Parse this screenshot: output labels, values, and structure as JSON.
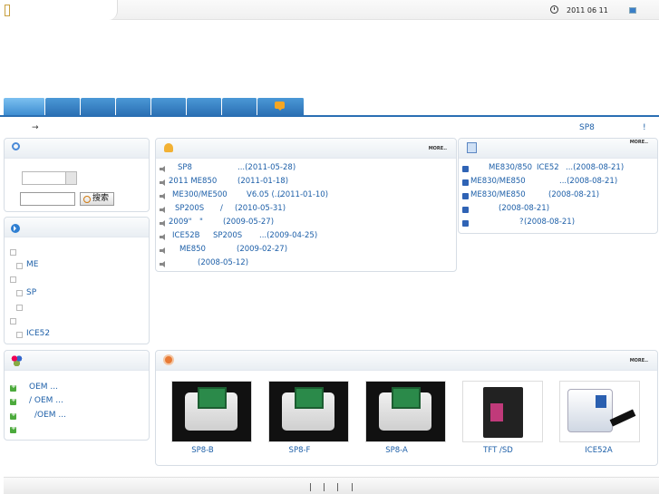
{
  "header": {
    "date": "2011 06 11"
  },
  "breadcrumb": {
    "arrow": "→"
  },
  "announcement": {
    "text": "SP8",
    "suffix": "!"
  },
  "search_box": {
    "button_label": "搜索"
  },
  "categories": {
    "items": [
      "",
      "ME",
      "",
      "SP",
      "",
      "",
      "ICE52"
    ]
  },
  "news": {
    "more": "MORE..",
    "items": [
      {
        "title": "SP8",
        "date": "...(2011-05-28)"
      },
      {
        "title": "2011  ME850",
        "date": "(2011-01-18)"
      },
      {
        "title": "ME300/ME500",
        "mid": "V6.05 (...",
        "date": "(2011-01-10)"
      },
      {
        "title": "SP200S",
        "mid": "/",
        "date": "(2010-05-31)"
      },
      {
        "title": "2009\"",
        "mid": "\"",
        "date": "(2009-05-27)"
      },
      {
        "title": "ICE52B",
        "mid": "SP200S",
        "date": "...(2009-04-25)"
      },
      {
        "title": "ME850",
        "date": "(2009-02-27)"
      },
      {
        "title": "",
        "date": "(2008-05-12)"
      }
    ]
  },
  "downloads": {
    "more": "MORE..",
    "items": [
      {
        "title": "ME830/850",
        "mid": "ICE52",
        "date": "...(2008-08-21)"
      },
      {
        "title": "ME830/ME850",
        "date": "...(2008-08-21)"
      },
      {
        "title": "ME830/ME850",
        "date": "(2008-08-21)"
      },
      {
        "title": "",
        "date": "(2008-08-21)"
      },
      {
        "title": "?",
        "date": "(2008-08-21)"
      }
    ]
  },
  "partners": {
    "items": [
      "OEM ...",
      "/   OEM ...",
      "/OEM ...",
      ""
    ]
  },
  "products": {
    "more": "MORE..",
    "items": [
      {
        "label": "SP8-B"
      },
      {
        "label": "SP8-F"
      },
      {
        "label": "SP8-A"
      },
      {
        "label": "TFT  /SD"
      },
      {
        "label": "ICE52A"
      }
    ]
  },
  "footer": {
    "separators": [
      "|",
      "|",
      "|",
      "|"
    ]
  },
  "colors": {
    "accent": "#2a6fb3",
    "link": "#1d5fa8"
  }
}
